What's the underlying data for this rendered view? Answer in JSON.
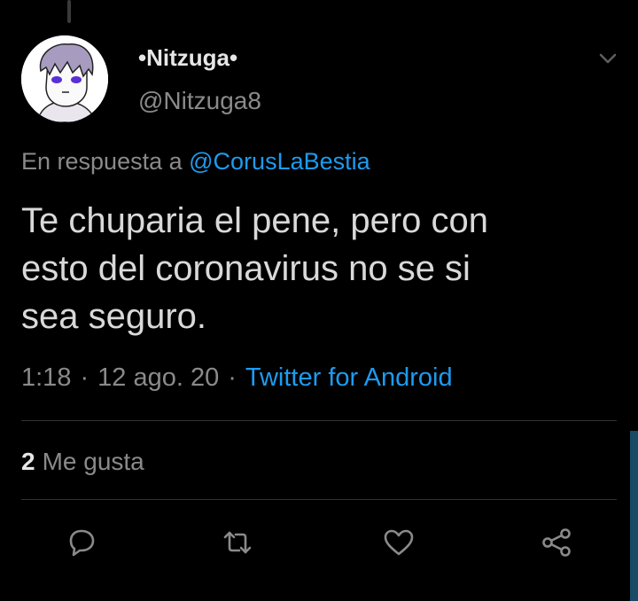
{
  "tweet": {
    "display_name": "•Nitzuga•",
    "handle": "@Nitzuga8",
    "reply_prefix": "En respuesta a",
    "reply_to": "@CorusLaBestia",
    "text": "Te chuparia el pene, pero con\nesto del coronavirus no se si\nsea seguro.",
    "time": "1:18",
    "date": "12 ago. 20",
    "source": "Twitter for Android",
    "likes_count": "2",
    "likes_label": "Me gusta"
  },
  "icons": {
    "menu": "chevron-down-icon",
    "reply": "reply-icon",
    "retweet": "retweet-icon",
    "like": "heart-icon",
    "share": "share-icon"
  },
  "colors": {
    "background": "#000000",
    "link": "#1d9bf0",
    "secondary_text": "#8a8a8a",
    "primary_text": "#d9d9d9"
  }
}
